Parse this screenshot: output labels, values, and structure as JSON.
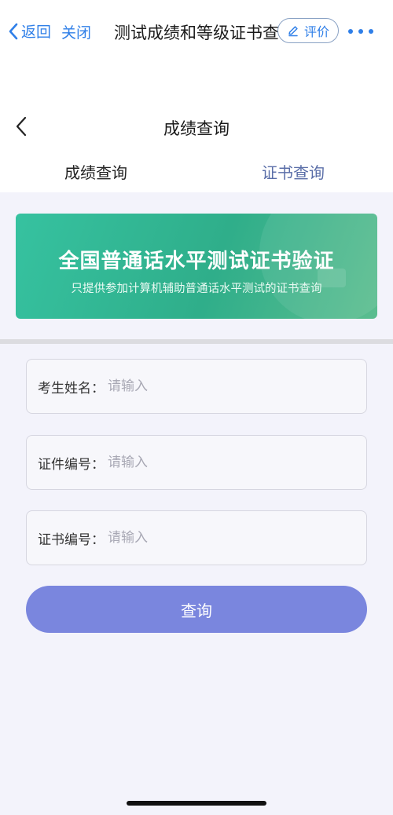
{
  "mp_bar": {
    "back_label": "返回",
    "close_label": "关闭",
    "title": "测试成绩和等级证书查询",
    "review_label": "评价"
  },
  "header": {
    "title": "成绩查询"
  },
  "tabs": [
    {
      "label": "成绩查询",
      "active": false
    },
    {
      "label": "证书查询",
      "active": true
    }
  ],
  "banner": {
    "title": "全国普通话水平测试证书验证",
    "subtitle": "只提供参加计算机辅助普通话水平测试的证书查询"
  },
  "form": {
    "fields": [
      {
        "label": "考生姓名：",
        "placeholder": "请输入",
        "value": ""
      },
      {
        "label": "证件编号：",
        "placeholder": "请输入",
        "value": ""
      },
      {
        "label": "证书编号：",
        "placeholder": "请输入",
        "value": ""
      }
    ],
    "submit_label": "查询"
  },
  "colors": {
    "accent_blue": "#2f7fe8",
    "banner_green": "#2fae8a",
    "button_purple": "#7a86de",
    "tab_active": "#5a6ea8"
  }
}
